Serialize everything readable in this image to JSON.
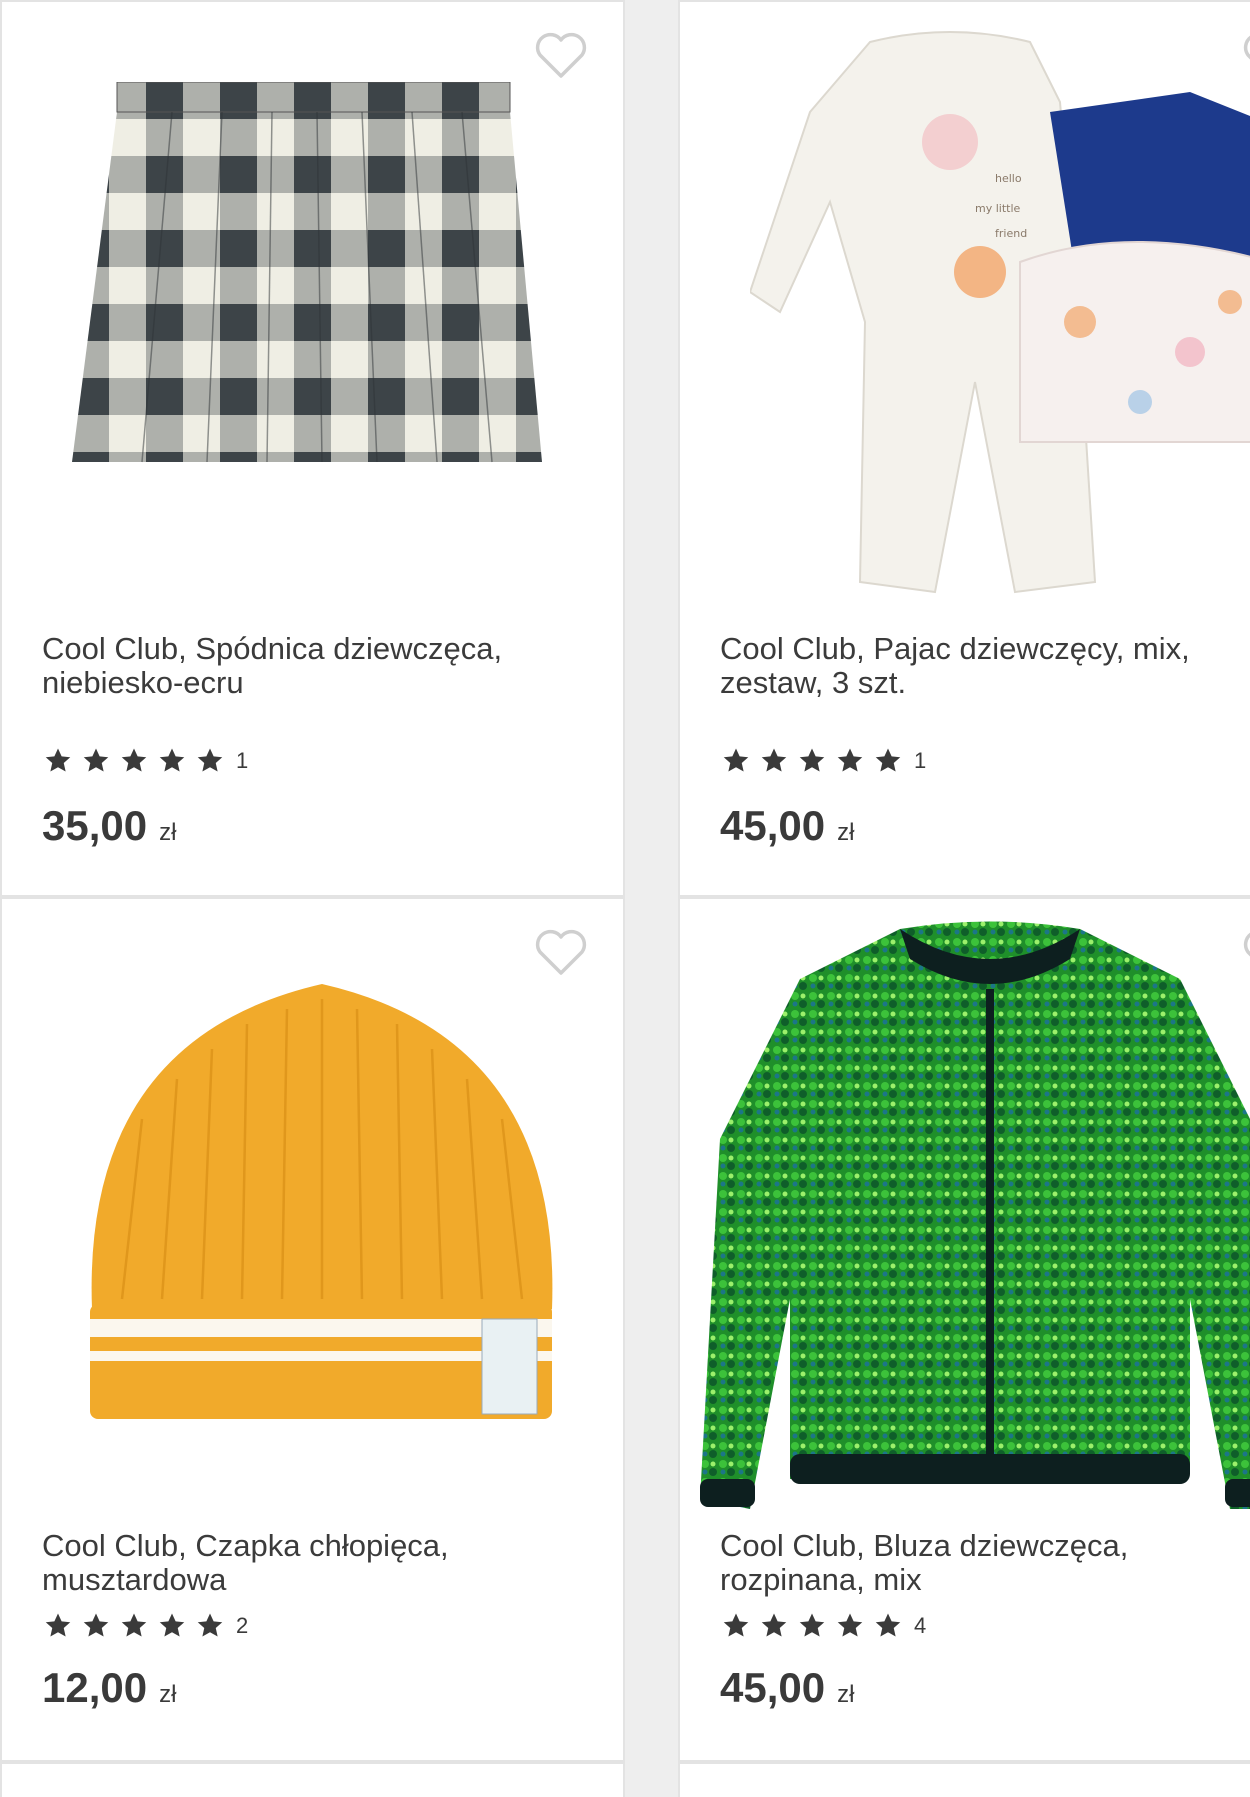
{
  "products": [
    {
      "title": "Cool Club, Spódnica dziewczęca, niebiesko-ecru",
      "rating_count": "1",
      "price": "35,00",
      "currency": "zł",
      "stars": 5
    },
    {
      "title": "Cool Club, Pajac dziewczęcy, mix, zestaw, 3 szt.",
      "rating_count": "1",
      "price": "45,00",
      "currency": "zł",
      "stars": 5
    },
    {
      "title": "Cool Club, Czapka chłopięca, musztardowa",
      "rating_count": "2",
      "price": "12,00",
      "currency": "zł",
      "stars": 5
    },
    {
      "title": "Cool Club, Bluza dziewczęca, rozpinana, mix",
      "rating_count": "4",
      "price": "45,00",
      "currency": "zł",
      "stars": 5
    }
  ],
  "icons": {
    "favorite": "heart-outline-icon",
    "star": "star-icon"
  },
  "colors": {
    "text": "#3a3a3a",
    "heart": "#cfcfcf",
    "star": "#3a3a3a",
    "card_border": "#e3e3e3"
  }
}
